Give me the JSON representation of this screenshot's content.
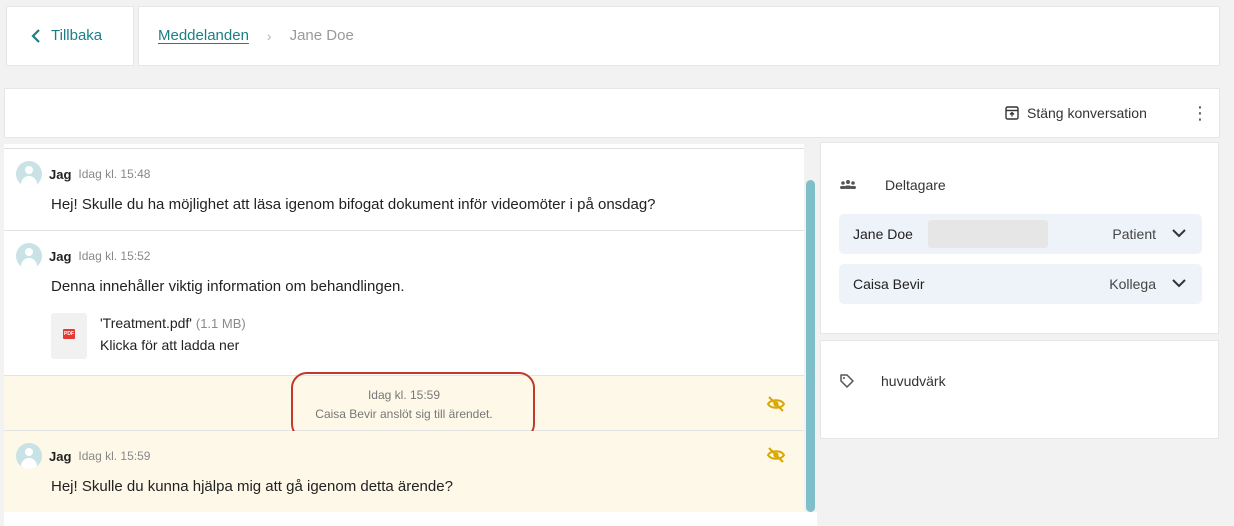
{
  "nav": {
    "back_label": "Tillbaka",
    "breadcrumb_link": "Meddelanden",
    "breadcrumb_current": "Jane Doe"
  },
  "toolbar": {
    "close_label": "Stäng konversation",
    "menu_icon": "kebab-icon"
  },
  "messages": [
    {
      "sender": "Jag",
      "time": "Idag kl. 15:48",
      "text": "Hej! Skulle du ha möjlighet att läsa igenom bifogat dokument inför videomöter i på onsdag?"
    },
    {
      "sender": "Jag",
      "time": "Idag kl. 15:52",
      "text": "Denna innehåller viktig information om behandlingen.",
      "attachment": {
        "name": "'Treatment.pdf'",
        "size": "(1.1 MB)",
        "action": "Klicka för att ladda ner"
      }
    },
    {
      "system": true,
      "time": "Idag kl. 15:59",
      "text": "Caisa Bevir anslöt sig till ärendet."
    },
    {
      "sender": "Jag",
      "time": "Idag kl. 15:59",
      "text": "Hej! Skulle du kunna hjälpa mig att gå igenom detta ärende?"
    }
  ],
  "participants": {
    "title": "Deltagare",
    "items": [
      {
        "name": "Jane Doe",
        "role": "Patient"
      },
      {
        "name": "Caisa Bevir",
        "role": "Kollega"
      }
    ]
  },
  "tags": {
    "label": "huvudvärk"
  },
  "colors": {
    "accent": "#1d7e86",
    "highlight_bg": "#fdf8e8",
    "eye_icon": "#d9a800",
    "annotation": "#c0392b",
    "scrollbar": "#7fbfca"
  }
}
